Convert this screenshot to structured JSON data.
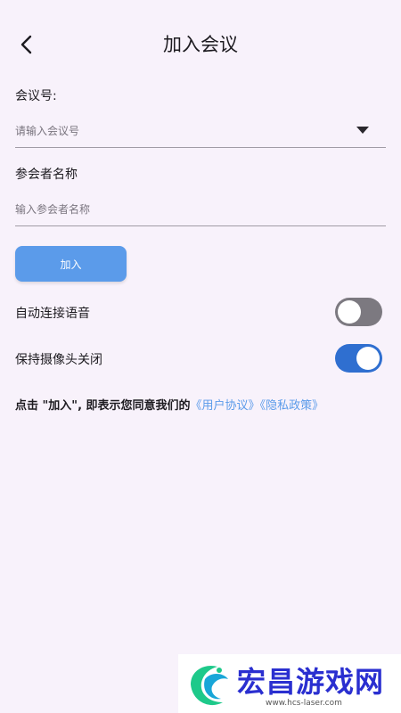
{
  "header": {
    "title": "加入会议",
    "back_icon": "chevron-left-icon"
  },
  "meeting_id": {
    "label": "会议号:",
    "value": "",
    "placeholder": "请输入会议号",
    "dropdown_icon": "caret-down-icon"
  },
  "participant_name": {
    "label": "参会者名称",
    "value": "",
    "placeholder": "输入参会者名称"
  },
  "join_button": {
    "label": "加入",
    "color": "#5b9bea"
  },
  "toggles": [
    {
      "label": "自动连接语音",
      "state": "off"
    },
    {
      "label": "保持摄像头关闭",
      "state": "on"
    }
  ],
  "agreement": {
    "text": "点击 \"加入\", 即表示您同意我们的",
    "user_agreement": "《用户协议》",
    "privacy_policy": "《隐私政策》"
  },
  "watermark": {
    "title": "宏昌游戏网",
    "url": "www.hcs-laser.com"
  },
  "colors": {
    "background": "#f8f2fb",
    "accent": "#5b9bea",
    "toggle_on": "#2f6fd0",
    "toggle_off": "#7c7980"
  }
}
